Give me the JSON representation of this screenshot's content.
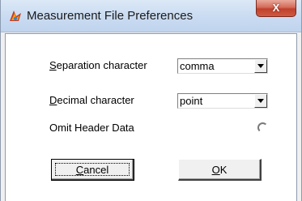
{
  "window": {
    "title": "Measurement File Preferences",
    "close_label": "X"
  },
  "form": {
    "separation": {
      "label_first": "S",
      "label_rest": "eparation character",
      "value": "comma"
    },
    "decimal": {
      "label_first": "D",
      "label_rest": "ecimal character",
      "value": "point"
    },
    "omit_header": {
      "label": "Omit Header Data",
      "checked": false
    }
  },
  "buttons": {
    "cancel_first": "C",
    "cancel_rest": "ancel",
    "ok_first": "O",
    "ok_rest": "K"
  }
}
